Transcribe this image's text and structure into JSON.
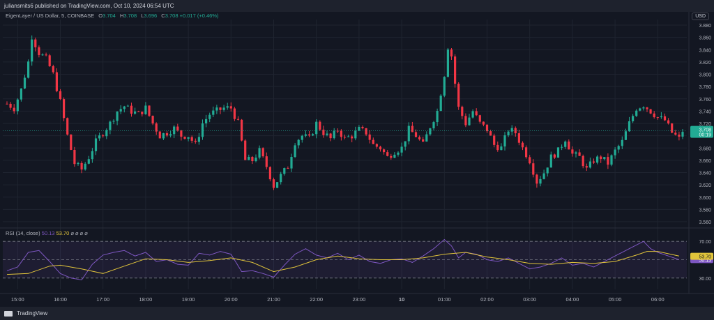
{
  "header": {
    "published": "juliansmits6 published on TradingView.com, Oct 10, 2024 06:54 UTC",
    "currency": "USD"
  },
  "legend": {
    "symbol": "EigenLayer / US Dollar, 5, COINBASE",
    "o_label": "O",
    "o": "3.704",
    "h_label": "H",
    "h": "3.708",
    "l_label": "L",
    "l": "3.696",
    "c_label": "C",
    "c": "3.708",
    "chg": "+0.017 (+0.46%)"
  },
  "rsi": {
    "title": "RSI (14, close)",
    "v1": "50.13",
    "v2": "53.70",
    "icons": "⌀ ⌀ ⌀ ⌀"
  },
  "footer": {
    "brand": "TradingView"
  },
  "colors": {
    "up": "#22ab94",
    "down": "#f23645",
    "rsi": "#7e57c2",
    "ma": "#e2c53b",
    "band": "#7e57c2"
  },
  "chart_data": [
    {
      "type": "candlestick",
      "title": "EigenLayer / US Dollar, 5, COINBASE",
      "ylim": [
        3.56,
        3.88
      ],
      "y_ticks": [
        "3.880",
        "3.860",
        "3.840",
        "3.820",
        "3.800",
        "3.780",
        "3.760",
        "3.740",
        "3.720",
        "3.700",
        "3.680",
        "3.660",
        "3.640",
        "3.620",
        "3.600",
        "3.580",
        "3.560"
      ],
      "price_labels": [
        {
          "value": "3.708",
          "color": "#22ab94"
        },
        {
          "value": "00:19",
          "color": "#22ab94"
        }
      ],
      "x_ticks": [
        "15:00",
        "16:00",
        "17:00",
        "18:00",
        "19:00",
        "20:00",
        "21:00",
        "22:00",
        "23:00",
        "10",
        "01:00",
        "02:00",
        "03:00",
        "04:00",
        "05:00",
        "06:00"
      ],
      "close_anchors": [
        [
          "14:45",
          3.752
        ],
        [
          "14:55",
          3.745
        ],
        [
          "15:05",
          3.775
        ],
        [
          "15:15",
          3.82
        ],
        [
          "15:20",
          3.862
        ],
        [
          "15:30",
          3.835
        ],
        [
          "15:40",
          3.825
        ],
        [
          "15:50",
          3.8
        ],
        [
          "16:00",
          3.755
        ],
        [
          "16:10",
          3.7
        ],
        [
          "16:20",
          3.655
        ],
        [
          "16:30",
          3.645
        ],
        [
          "16:40",
          3.665
        ],
        [
          "16:50",
          3.69
        ],
        [
          "17:00",
          3.705
        ],
        [
          "17:10",
          3.72
        ],
        [
          "17:20",
          3.74
        ],
        [
          "17:30",
          3.748
        ],
        [
          "17:40",
          3.74
        ],
        [
          "17:50",
          3.735
        ],
        [
          "18:00",
          3.745
        ],
        [
          "18:10",
          3.72
        ],
        [
          "18:20",
          3.7
        ],
        [
          "18:30",
          3.705
        ],
        [
          "18:40",
          3.712
        ],
        [
          "18:50",
          3.7
        ],
        [
          "19:00",
          3.7
        ],
        [
          "19:10",
          3.685
        ],
        [
          "19:20",
          3.72
        ],
        [
          "19:30",
          3.735
        ],
        [
          "19:40",
          3.74
        ],
        [
          "19:50",
          3.745
        ],
        [
          "20:00",
          3.745
        ],
        [
          "20:10",
          3.72
        ],
        [
          "20:20",
          3.66
        ],
        [
          "20:30",
          3.66
        ],
        [
          "20:40",
          3.675
        ],
        [
          "20:50",
          3.65
        ],
        [
          "21:00",
          3.618
        ],
        [
          "21:10",
          3.635
        ],
        [
          "21:20",
          3.65
        ],
        [
          "21:30",
          3.69
        ],
        [
          "21:40",
          3.7
        ],
        [
          "21:50",
          3.695
        ],
        [
          "22:00",
          3.72
        ],
        [
          "22:10",
          3.705
        ],
        [
          "22:20",
          3.695
        ],
        [
          "22:30",
          3.71
        ],
        [
          "22:40",
          3.695
        ],
        [
          "22:50",
          3.7
        ],
        [
          "23:00",
          3.71
        ],
        [
          "23:10",
          3.705
        ],
        [
          "23:20",
          3.685
        ],
        [
          "23:30",
          3.68
        ],
        [
          "23:40",
          3.665
        ],
        [
          "23:50",
          3.675
        ],
        [
          "00:00",
          3.68
        ],
        [
          "00:10",
          3.71
        ],
        [
          "00:20",
          3.7
        ],
        [
          "00:30",
          3.685
        ],
        [
          "00:40",
          3.715
        ],
        [
          "00:50",
          3.74
        ],
        [
          "01:00",
          3.8
        ],
        [
          "01:05",
          3.845
        ],
        [
          "01:10",
          3.83
        ],
        [
          "01:15",
          3.785
        ],
        [
          "01:20",
          3.745
        ],
        [
          "01:30",
          3.72
        ],
        [
          "01:40",
          3.74
        ],
        [
          "01:50",
          3.72
        ],
        [
          "02:00",
          3.71
        ],
        [
          "02:10",
          3.685
        ],
        [
          "02:20",
          3.68
        ],
        [
          "02:30",
          3.71
        ],
        [
          "02:40",
          3.705
        ],
        [
          "02:50",
          3.68
        ],
        [
          "03:00",
          3.66
        ],
        [
          "03:10",
          3.625
        ],
        [
          "03:20",
          3.64
        ],
        [
          "03:30",
          3.665
        ],
        [
          "03:40",
          3.675
        ],
        [
          "03:50",
          3.695
        ],
        [
          "04:00",
          3.67
        ],
        [
          "04:10",
          3.665
        ],
        [
          "04:20",
          3.645
        ],
        [
          "04:30",
          3.66
        ],
        [
          "04:40",
          3.665
        ],
        [
          "04:50",
          3.655
        ],
        [
          "05:00",
          3.675
        ],
        [
          "05:10",
          3.69
        ],
        [
          "05:20",
          3.72
        ],
        [
          "05:30",
          3.745
        ],
        [
          "05:40",
          3.75
        ],
        [
          "05:50",
          3.74
        ],
        [
          "06:00",
          3.73
        ],
        [
          "06:10",
          3.725
        ],
        [
          "06:20",
          3.705
        ],
        [
          "06:30",
          3.695
        ],
        [
          "06:35",
          3.708
        ]
      ]
    },
    {
      "type": "line",
      "title": "RSI (14, close)",
      "ylim": [
        20,
        80
      ],
      "y_ticks": [
        "70.00",
        "30.00"
      ],
      "bands": [
        30,
        50,
        70
      ],
      "series": [
        {
          "name": "RSI",
          "color": "#7e57c2",
          "last": "50.13",
          "values": [
            [
              "14:45",
              38
            ],
            [
              "15:00",
              42
            ],
            [
              "15:15",
              58
            ],
            [
              "15:30",
              60
            ],
            [
              "15:45",
              48
            ],
            [
              "16:00",
              35
            ],
            [
              "16:15",
              30
            ],
            [
              "16:30",
              28
            ],
            [
              "16:45",
              45
            ],
            [
              "17:00",
              55
            ],
            [
              "17:15",
              58
            ],
            [
              "17:30",
              60
            ],
            [
              "17:45",
              54
            ],
            [
              "18:00",
              58
            ],
            [
              "18:15",
              48
            ],
            [
              "18:30",
              50
            ],
            [
              "18:45",
              45
            ],
            [
              "19:00",
              44
            ],
            [
              "19:15",
              57
            ],
            [
              "19:30",
              55
            ],
            [
              "19:45",
              59
            ],
            [
              "20:00",
              56
            ],
            [
              "20:15",
              37
            ],
            [
              "20:30",
              38
            ],
            [
              "20:45",
              35
            ],
            [
              "21:00",
              31
            ],
            [
              "21:15",
              44
            ],
            [
              "21:30",
              56
            ],
            [
              "21:45",
              62
            ],
            [
              "22:00",
              55
            ],
            [
              "22:15",
              52
            ],
            [
              "22:30",
              57
            ],
            [
              "22:45",
              50
            ],
            [
              "23:00",
              55
            ],
            [
              "23:15",
              48
            ],
            [
              "23:30",
              46
            ],
            [
              "23:45",
              50
            ],
            [
              "00:00",
              51
            ],
            [
              "00:15",
              47
            ],
            [
              "00:30",
              54
            ],
            [
              "00:45",
              62
            ],
            [
              "01:00",
              72
            ],
            [
              "01:10",
              65
            ],
            [
              "01:20",
              52
            ],
            [
              "01:30",
              58
            ],
            [
              "01:45",
              56
            ],
            [
              "02:00",
              50
            ],
            [
              "02:15",
              48
            ],
            [
              "02:30",
              52
            ],
            [
              "02:45",
              46
            ],
            [
              "03:00",
              40
            ],
            [
              "03:15",
              42
            ],
            [
              "03:30",
              46
            ],
            [
              "03:45",
              52
            ],
            [
              "04:00",
              44
            ],
            [
              "04:15",
              46
            ],
            [
              "04:30",
              42
            ],
            [
              "04:45",
              48
            ],
            [
              "05:00",
              54
            ],
            [
              "05:15",
              60
            ],
            [
              "05:30",
              66
            ],
            [
              "05:40",
              70
            ],
            [
              "05:50",
              62
            ],
            [
              "06:00",
              58
            ],
            [
              "06:15",
              54
            ],
            [
              "06:30",
              50
            ]
          ]
        },
        {
          "name": "MA",
          "color": "#e2c53b",
          "last": "53.70",
          "values": [
            [
              "14:45",
              34
            ],
            [
              "15:15",
              35
            ],
            [
              "15:45",
              43
            ],
            [
              "16:00",
              44
            ],
            [
              "16:30",
              40
            ],
            [
              "17:00",
              35
            ],
            [
              "17:30",
              43
            ],
            [
              "18:00",
              51
            ],
            [
              "18:30",
              50
            ],
            [
              "19:00",
              47
            ],
            [
              "19:30",
              49
            ],
            [
              "20:00",
              52
            ],
            [
              "20:30",
              47
            ],
            [
              "21:00",
              37
            ],
            [
              "21:30",
              42
            ],
            [
              "22:00",
              50
            ],
            [
              "22:30",
              54
            ],
            [
              "23:00",
              51
            ],
            [
              "23:30",
              50
            ],
            [
              "00:00",
              50
            ],
            [
              "00:30",
              52
            ],
            [
              "01:00",
              56
            ],
            [
              "01:30",
              58
            ],
            [
              "02:00",
              53
            ],
            [
              "02:30",
              50
            ],
            [
              "03:00",
              46
            ],
            [
              "03:30",
              45
            ],
            [
              "04:00",
              47
            ],
            [
              "04:30",
              46
            ],
            [
              "05:00",
              48
            ],
            [
              "05:30",
              55
            ],
            [
              "05:45",
              59
            ],
            [
              "06:00",
              59
            ],
            [
              "06:30",
              54
            ]
          ]
        }
      ]
    }
  ]
}
